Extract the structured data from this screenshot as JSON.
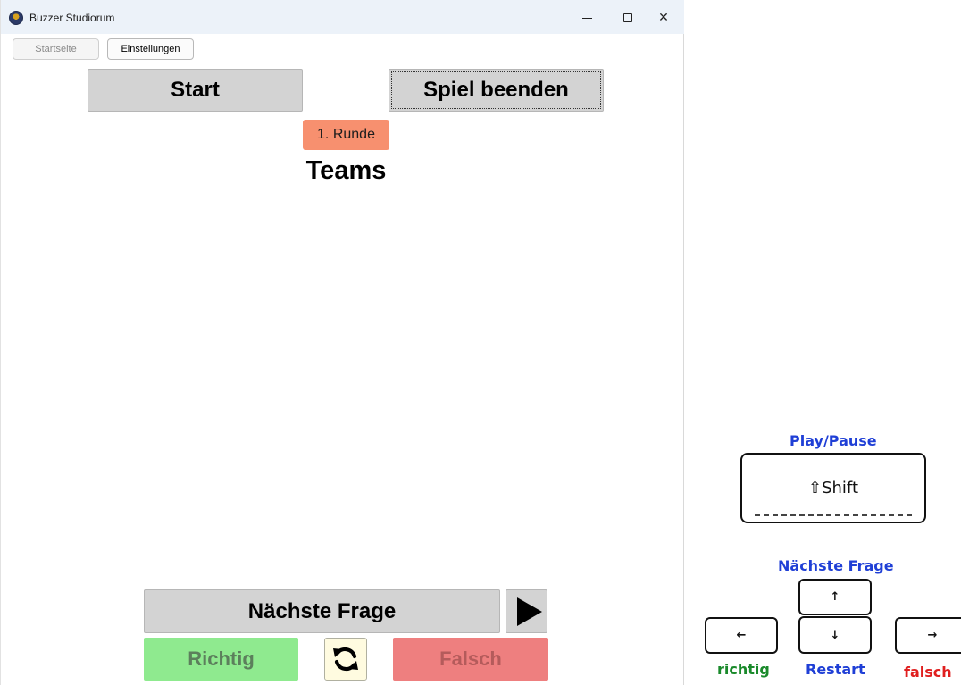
{
  "window": {
    "title": "Buzzer Studiorum",
    "controls": {
      "minimize": "minimize-icon",
      "maximize": "maximize-icon",
      "close": "close-icon"
    }
  },
  "toolbar": {
    "tabs": [
      {
        "label": "Startseite",
        "enabled": false
      },
      {
        "label": "Einstellungen",
        "enabled": true
      }
    ]
  },
  "actions": {
    "start_label": "Start",
    "end_label": "Spiel beenden"
  },
  "game": {
    "round_label": "1. Runde",
    "heading": "Teams"
  },
  "controls": {
    "next_question_label": "Nächste Frage",
    "play_icon": "play-icon",
    "correct_label": "Richtig",
    "refresh_icon": "refresh-icon",
    "wrong_label": "Falsch"
  },
  "legend": {
    "play_pause": "Play/Pause",
    "shift_key": "⇧Shift",
    "next_question": "Nächste Frage",
    "up_key": "↑",
    "down_key": "↓",
    "left_key": "←",
    "right_key": "→",
    "right_label": "richtig",
    "restart_label": "Restart",
    "wrong_label": "falsch"
  },
  "colors": {
    "round_badge": "#f7906f",
    "correct": "#8fea8f",
    "wrong": "#ee7f7f",
    "legend_blue": "#1f3fd6",
    "legend_green": "#1a8a2b",
    "legend_red": "#e01f1f"
  }
}
